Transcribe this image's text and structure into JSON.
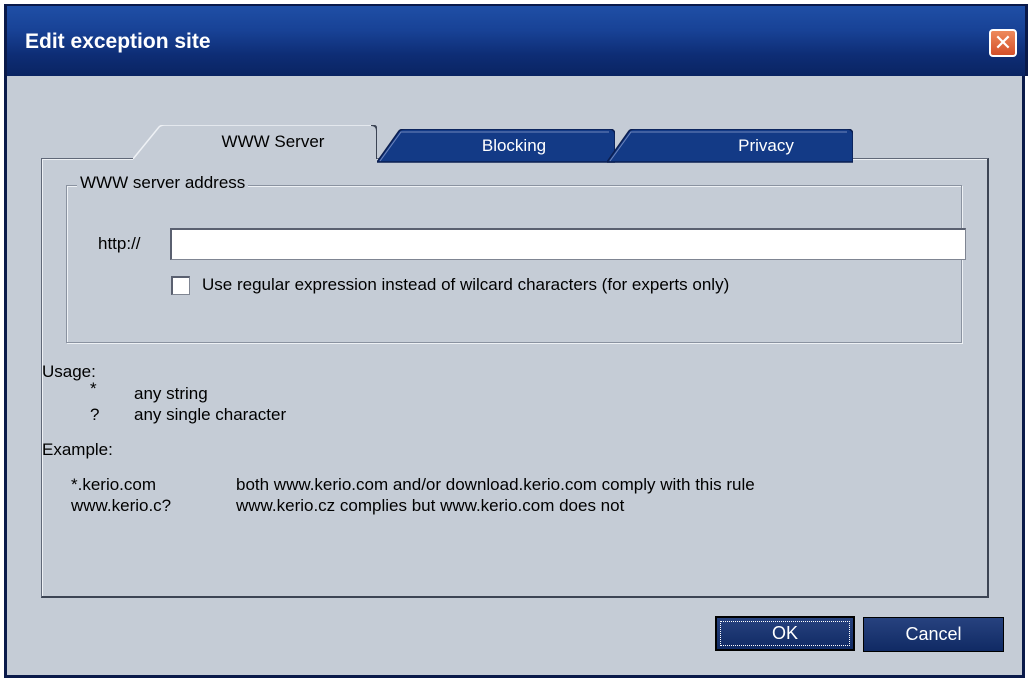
{
  "window": {
    "title": "Edit exception site",
    "close_symbol": "✕"
  },
  "tabs": [
    {
      "label": "WWW Server",
      "active": true
    },
    {
      "label": "Blocking",
      "active": false
    },
    {
      "label": "Privacy",
      "active": false
    }
  ],
  "group": {
    "legend": "WWW server address",
    "prefix_label": "http://",
    "url_value": "",
    "checkbox_label": "Use regular expression instead of wilcard characters (for experts only)",
    "checkbox_checked": false
  },
  "usage": {
    "heading": "Usage:",
    "rows": [
      {
        "symbol": "*",
        "meaning": "any string"
      },
      {
        "symbol": "?",
        "meaning": "any single character"
      }
    ]
  },
  "example": {
    "heading": "Example:",
    "rows": [
      {
        "pattern": "*.kerio.com",
        "description": "both www.kerio.com and/or download.kerio.com comply with this rule"
      },
      {
        "pattern": "www.kerio.c?",
        "description": "www.kerio.cz complies but www.kerio.com does not"
      }
    ]
  },
  "buttons": {
    "ok": "OK",
    "cancel": "Cancel"
  },
  "colors": {
    "titlebar": "#184296",
    "dialog_bg": "#c5ccd6",
    "button_bg": "#1a3370",
    "close_button": "#d4502a"
  }
}
